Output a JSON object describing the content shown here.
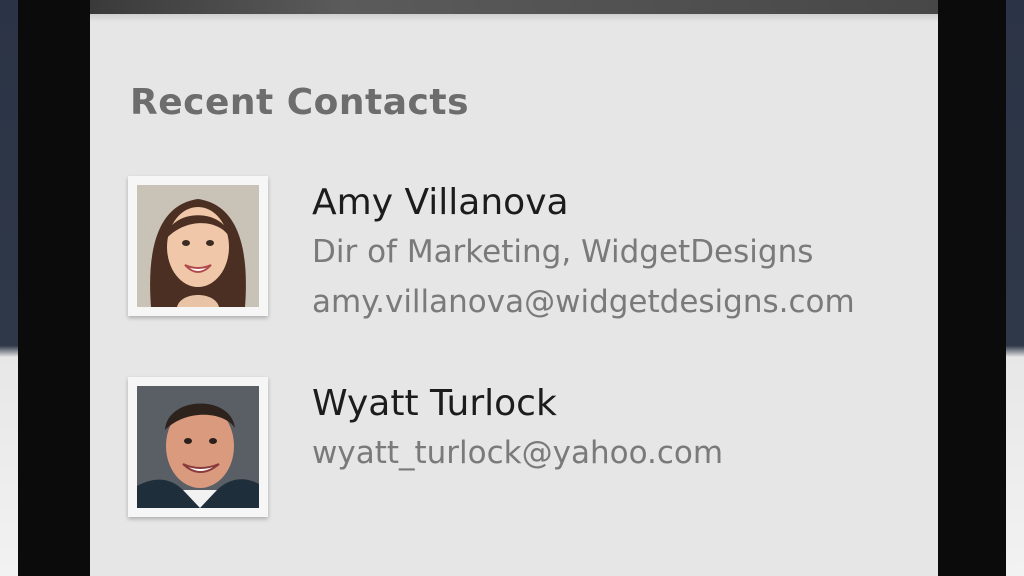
{
  "section": {
    "title": "Recent Contacts"
  },
  "contacts": [
    {
      "name": "Amy Villanova",
      "title": "Dir of Marketing, WidgetDesigns",
      "email": "amy.villanova@widgetdesigns.com"
    },
    {
      "name": "Wyatt Turlock",
      "email": "wyatt_turlock@yahoo.com"
    }
  ]
}
